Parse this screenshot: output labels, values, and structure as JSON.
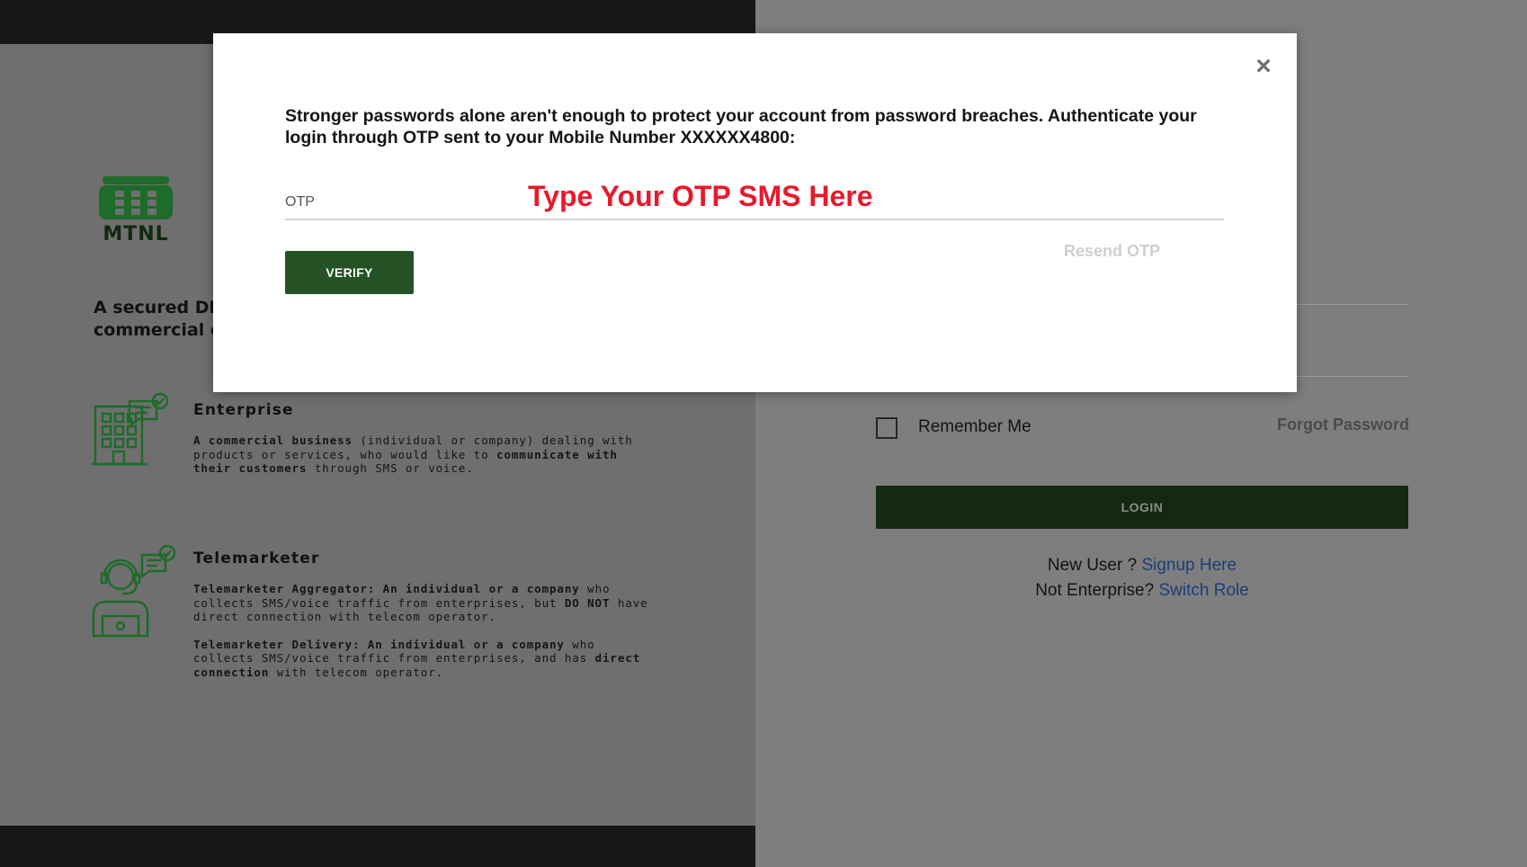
{
  "brand": {
    "logo_text": "MTNL",
    "logo_color": "#1e6b2a"
  },
  "left": {
    "tagline_lines": [
      "A secured DLT",
      "commercial co"
    ],
    "enterprise": {
      "title": "Enterprise",
      "desc_b1": "A commercial business",
      "desc_t1": " (individual or company) dealing with products or services, who would like to ",
      "desc_b2": "communicate with their customers",
      "desc_t2": " through SMS or voice."
    },
    "telemarketer": {
      "title": "Telemarketer",
      "agg_b1": "Telemarketer Aggregator: An individual or a company",
      "agg_t1": " who collects SMS/voice traffic from enterprises, but ",
      "agg_b2": "DO NOT",
      "agg_t2": " have direct connection with telecom operator.",
      "del_b1": "Telemarketer Delivery: An individual or a company",
      "del_t1": " who collects SMS/voice traffic from enterprises, and has ",
      "del_b2": "direct connection",
      "del_t2": " with telecom operator."
    }
  },
  "right": {
    "remember_label": "Remember Me",
    "forgot_label": "Forgot Password",
    "login_label": "LOGIN",
    "new_user_text": "New User ? ",
    "signup_link": "Signup Here",
    "not_enterprise_text": "Not Enterprise? ",
    "switch_role_link": "Switch Role"
  },
  "modal": {
    "close_symbol": "×",
    "message": "Stronger passwords alone aren't enough to protect your account from password breaches. Authenticate your login through OTP sent to your Mobile Number XXXXXX4800:",
    "otp_placeholder": "OTP",
    "otp_hint": "Type Your OTP SMS Here",
    "verify_label": "VERIFY",
    "resend_label": "Resend OTP"
  },
  "colors": {
    "dark_bar": "#181818",
    "login_button": "#132913",
    "verify_button": "#245224",
    "hint_red": "#e8192c",
    "link_blue": "#1c3e78"
  }
}
